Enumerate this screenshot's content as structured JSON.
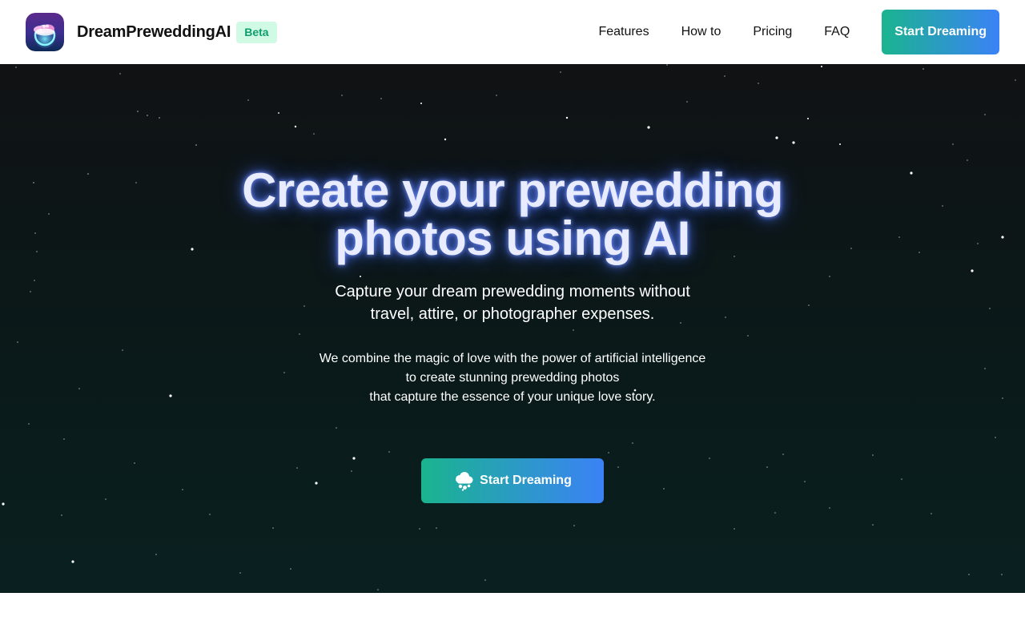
{
  "header": {
    "brand_name": "DreamPreweddingAI",
    "badge": "Beta",
    "nav": [
      {
        "label": "Features"
      },
      {
        "label": "How to"
      },
      {
        "label": "Pricing"
      },
      {
        "label": "FAQ"
      }
    ],
    "cta_label": "Start Dreaming"
  },
  "hero": {
    "title_lines": [
      "Create your prewedding",
      "photos using AI"
    ],
    "subtitle_lines": [
      "Capture your dream prewedding moments without",
      "travel, attire, or photographer expenses."
    ],
    "description_lines": [
      "We combine the magic of love with the power of artificial intelligence",
      "to create stunning prewedding photos",
      "that capture the essence of your unique love story."
    ],
    "cta_label": "Start Dreaming",
    "cta_icon": "cloud-icon"
  },
  "colors": {
    "accent_start": "#1ab48f",
    "accent_end": "#3b82f6",
    "badge_bg": "#d1fae5",
    "badge_text": "#0f9d6e",
    "hero_bg": "#0d1716",
    "title_glow": "#5078ff"
  },
  "icons": {
    "logo": "app-logo-icon",
    "hero_button": "cloud-icon"
  }
}
